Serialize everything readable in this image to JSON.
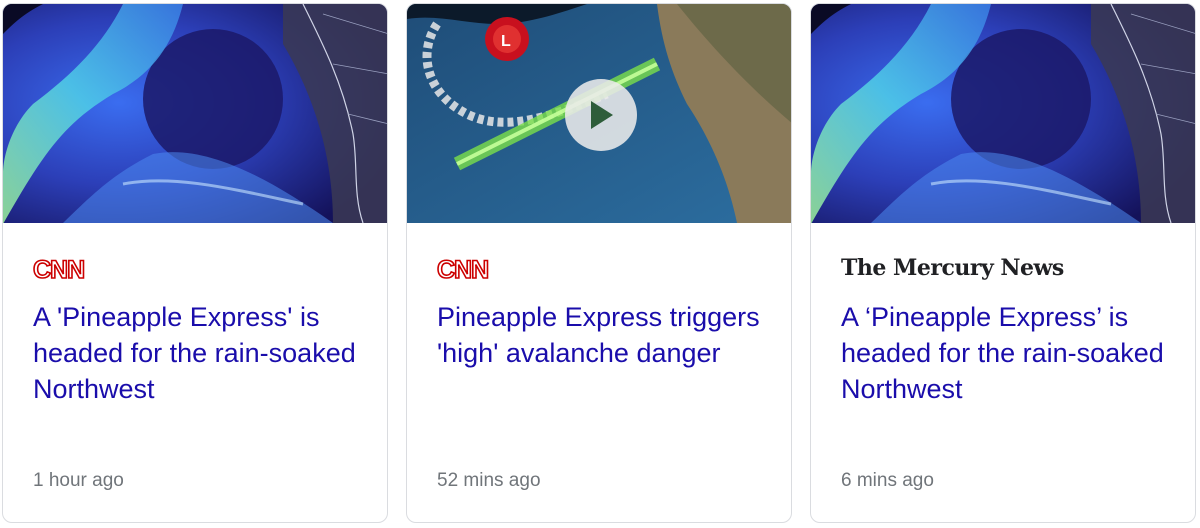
{
  "cards": [
    {
      "source": "CNN",
      "headline": "A 'Pineapple Express' is headed for the rain-soaked Northwest",
      "time": "1 hour ago",
      "has_video": false
    },
    {
      "source": "CNN",
      "headline": "Pineapple Express triggers 'high' avalanche danger",
      "time": "52 mins ago",
      "has_video": true
    },
    {
      "source": "The Mercury News",
      "headline": "A ‘Pineapple Express’ is headed for the rain-soaked Northwest",
      "time": "6 mins ago",
      "has_video": false
    }
  ],
  "colors": {
    "headline_link": "#1a0dab",
    "timestamp": "#70757a",
    "cnn_red": "#cc0000",
    "card_border": "#dadce0"
  },
  "icons": {
    "video_overlay": "play-icon"
  }
}
